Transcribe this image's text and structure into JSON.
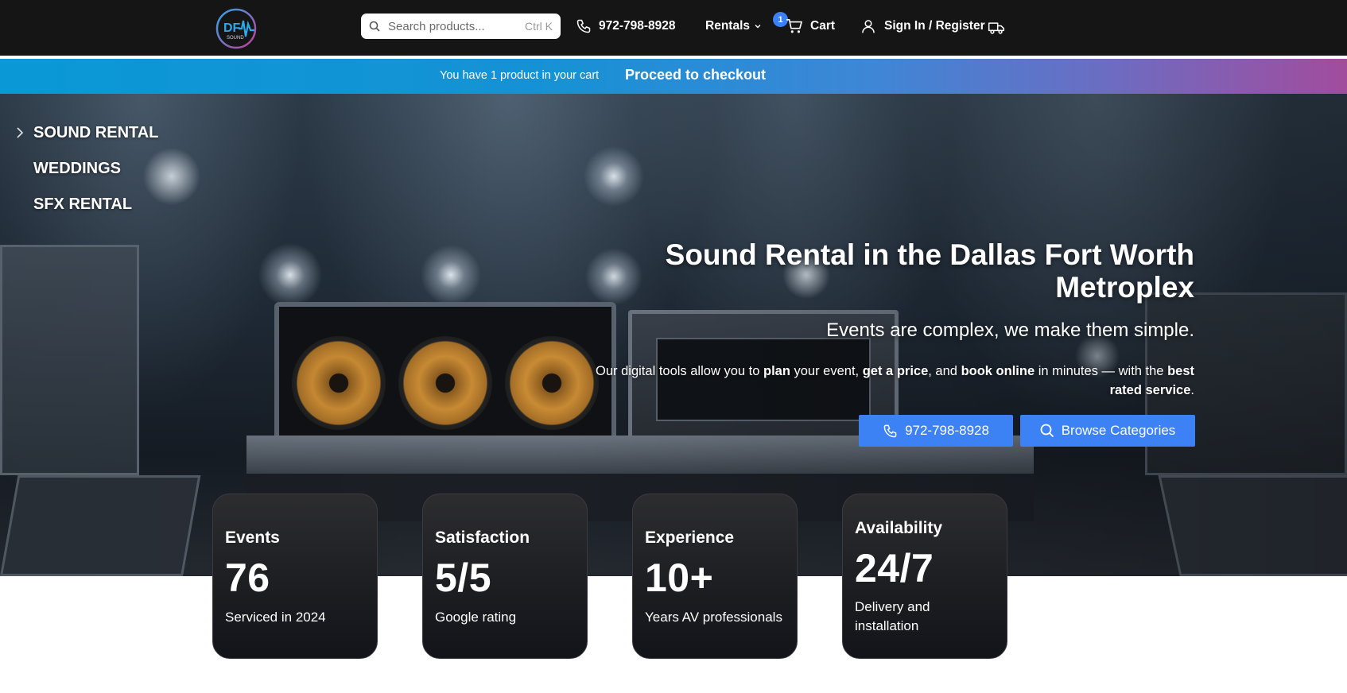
{
  "header": {
    "search": {
      "placeholder": "Search products...",
      "shortcut": "Ctrl K"
    },
    "phone": "972-798-8928",
    "rentals_label": "Rentals",
    "cart": {
      "label": "Cart",
      "count": "1"
    },
    "sign_in_label": "Sign In / Register",
    "icons": [
      "search-icon",
      "phone-icon",
      "chevron-down-icon",
      "cart-icon",
      "user-icon",
      "truck-icon"
    ]
  },
  "banner": {
    "message": "You have 1 product in your cart",
    "checkout_label": "Proceed to checkout"
  },
  "side_menu": {
    "items": [
      {
        "label": "SOUND RENTAL"
      },
      {
        "label": "WEDDINGS"
      },
      {
        "label": "SFX RENTAL"
      }
    ]
  },
  "hero": {
    "title": "Sound Rental in the Dallas Fort Worth Metroplex",
    "subtitle": "Events are complex, we make them simple.",
    "desc": {
      "p1": "Our digital tools allow you to ",
      "b1": "plan",
      "p2": " your event, ",
      "b2": "get a price",
      "p3": ", and ",
      "b3": "book online",
      "p4": " in minutes — with the ",
      "b4": "best rated service",
      "p5": "."
    },
    "phone_button": "972-798-8928",
    "browse_button": "Browse Categories"
  },
  "stats": [
    {
      "label": "Events",
      "value": "76",
      "desc": "Serviced in 2024"
    },
    {
      "label": "Satisfaction",
      "value": "5/5",
      "desc": "Google rating"
    },
    {
      "label": "Experience",
      "value": "10+",
      "desc": "Years AV professionals"
    },
    {
      "label": "Availability",
      "value": "24/7",
      "desc": "Delivery and installation"
    }
  ],
  "colors": {
    "header_bg": "#151516",
    "accent_blue": "#3c82f4",
    "banner_start": "#0a98d6",
    "banner_end": "#a24c9d",
    "card_bg": "#1d1e22"
  }
}
